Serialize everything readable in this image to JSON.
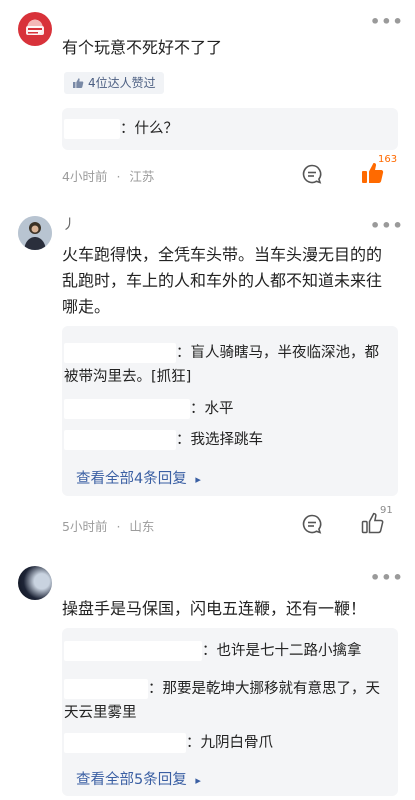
{
  "comments": [
    {
      "text": "有个玩意不死好不了了",
      "badge": "4位达人赞过",
      "replies": [
        "：什么？"
      ],
      "time": "4小时前",
      "location": "江苏",
      "likes": "163"
    },
    {
      "username": "丿",
      "text": "火车跑得快，全凭车头带。当车头漫无目的的乱跑时，车上的人和车外的人都不知道未来往哪走。",
      "replies": [
        "：盲人骑瞎马，半夜临深池，都被带沟里去。[抓狂]",
        "：水平",
        "：我选择跳车"
      ],
      "view_all": "查看全部4条回复",
      "time": "5小时前",
      "location": "山东",
      "likes": "91"
    },
    {
      "text": "操盘手是马保国，闪电五连鞭，还有一鞭！",
      "replies": [
        "：也许是七十二路小擒拿",
        "：那要是乾坤大挪移就有意思了，天天云里雾里",
        "：九阴白骨爪"
      ],
      "view_all": "查看全部5条回复"
    }
  ],
  "ui": {
    "dot": "·",
    "more_glyph": "•••",
    "arrow": "▸"
  },
  "colors": {
    "accent": "#ff6a00",
    "link": "#3a5fa3",
    "reply_bg": "#f4f5f7"
  },
  "icons": [
    "more-icon",
    "thumb-up-icon",
    "comment-icon"
  ]
}
